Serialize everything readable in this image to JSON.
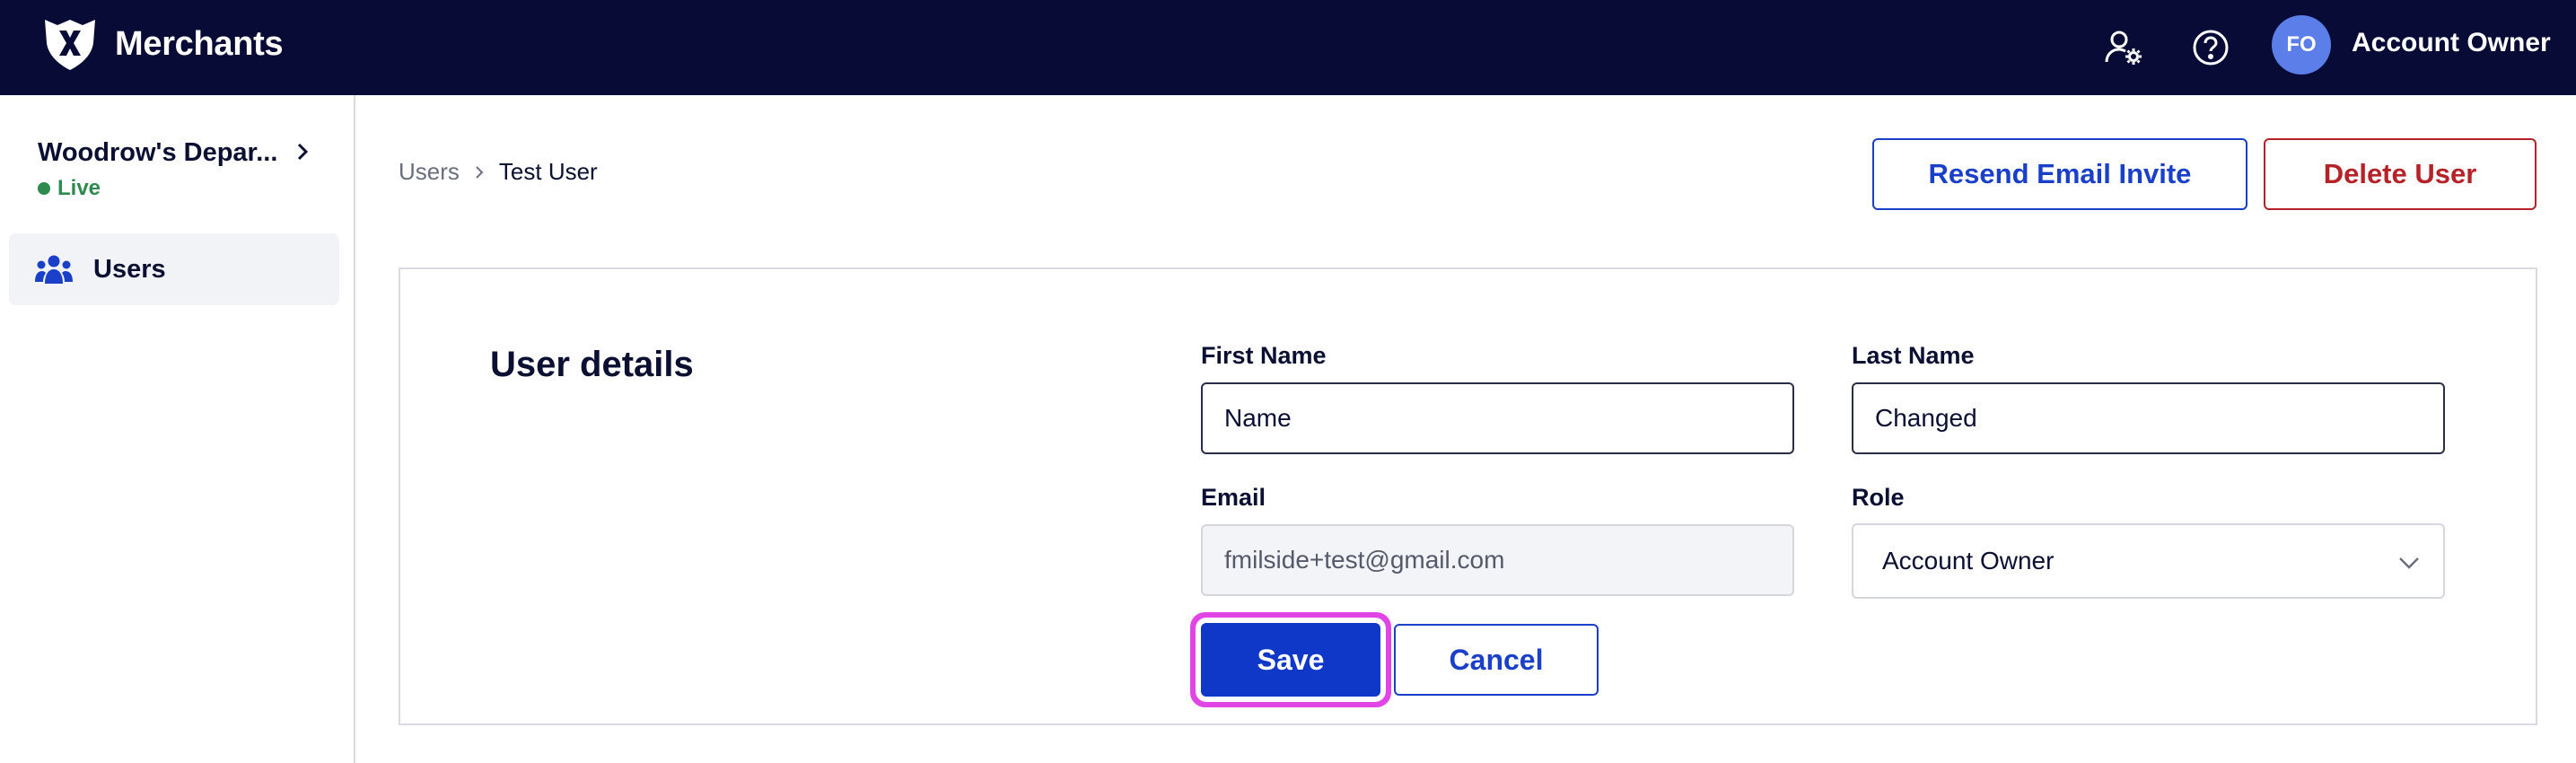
{
  "app": {
    "brand_name": "Merchants",
    "account": {
      "initials": "FO",
      "name": "Account Owner"
    }
  },
  "header_icons": [
    "user-settings-icon",
    "help-icon"
  ],
  "sidebar": {
    "merchant": {
      "name": "Woodrow's Depar...",
      "status": "Live"
    },
    "items": [
      {
        "label": "Users",
        "icon": "users-icon"
      }
    ]
  },
  "breadcrumb": {
    "parent": "Users",
    "current": "Test User"
  },
  "actions": {
    "resend_label": "Resend Email Invite",
    "delete_label": "Delete User"
  },
  "form": {
    "title": "User details",
    "first_name": {
      "label": "First Name",
      "value": "Name"
    },
    "last_name": {
      "label": "Last Name",
      "value": "Changed"
    },
    "email": {
      "label": "Email",
      "value": "fmilside+test@gmail.com"
    },
    "role": {
      "label": "Role",
      "value": "Account Owner"
    },
    "save_label": "Save",
    "cancel_label": "Cancel"
  },
  "colors": {
    "header_bg": "#070b36",
    "primary": "#0f38c8",
    "danger": "#b52329",
    "status_live": "#2e8a4f",
    "focus_ring": "#e245e6",
    "avatar": "#5b7ee8"
  }
}
